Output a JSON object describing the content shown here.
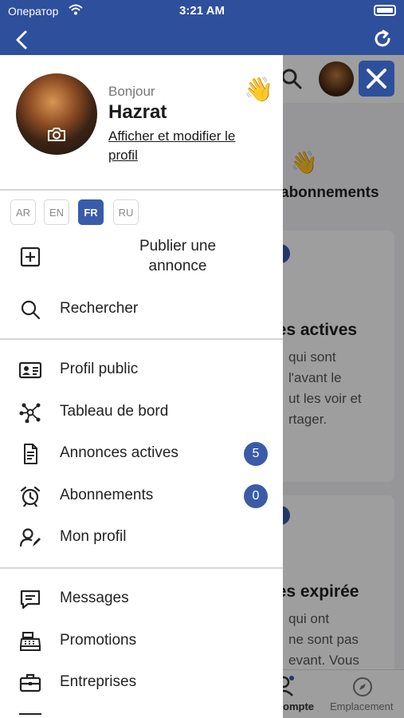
{
  "status_bar": {
    "carrier": "Оператор",
    "time": "3:21 AM"
  },
  "nav": {
    "back_icon": "chevron-left-icon",
    "refresh_icon": "refresh-icon"
  },
  "background": {
    "heading": "abonnements",
    "card1_title": "ces actives",
    "card1_text": "qui sont\nl'avant le\nut les voir et\nrtager.",
    "card2_title": "ces expirée",
    "card2_text": "qui ont\nne sont pas\nevant. Vous",
    "tab_compte": "ompte",
    "tab_emplacement": "Emplacement"
  },
  "profile": {
    "greeting": "Bonjour",
    "name": "Hazrat",
    "link": "Afficher et modifier le profil",
    "wave_emoji": "👋"
  },
  "languages": [
    {
      "code": "AR",
      "active": false
    },
    {
      "code": "EN",
      "active": false
    },
    {
      "code": "FR",
      "active": true
    },
    {
      "code": "RU",
      "active": false
    }
  ],
  "menu_top": [
    {
      "label": "Publier une annonce",
      "icon": "plus-square-icon"
    },
    {
      "label": "Rechercher",
      "icon": "search-icon"
    }
  ],
  "menu_mid": [
    {
      "label": "Profil public",
      "icon": "id-card-icon"
    },
    {
      "label": "Tableau de bord",
      "icon": "network-icon"
    },
    {
      "label": "Annonces actives",
      "icon": "document-icon",
      "count": "5"
    },
    {
      "label": "Abonnements",
      "icon": "alarm-clock-icon",
      "count": "0"
    },
    {
      "label": "Mon profil",
      "icon": "user-edit-icon"
    }
  ],
  "menu_bottom": [
    {
      "label": "Messages",
      "icon": "message-icon"
    },
    {
      "label": "Promotions",
      "icon": "cash-register-icon"
    },
    {
      "label": "Entreprises",
      "icon": "briefcase-icon"
    }
  ],
  "colors": {
    "primary": "#2e4f9c",
    "badge": "#3a5ba9",
    "divider": "#d6d6d6"
  }
}
